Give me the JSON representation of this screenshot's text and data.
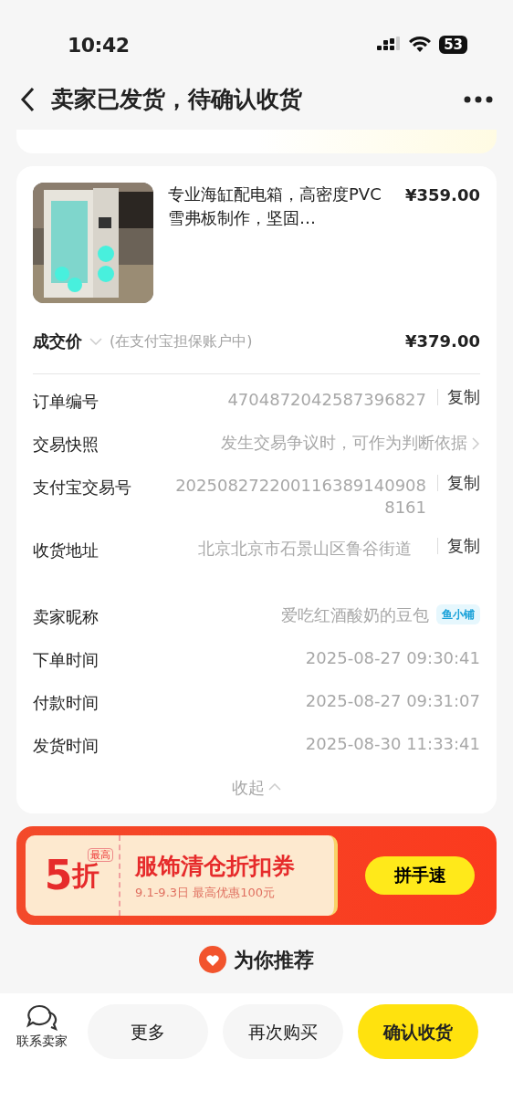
{
  "status_bar": {
    "time": "10:42",
    "battery": "53"
  },
  "header": {
    "title": "卖家已发货，待确认收货"
  },
  "product": {
    "title": "专业海缸配电箱，高密度PVC雪弗板制作，坚固…",
    "price": "¥359.00"
  },
  "deal": {
    "label": "成交价",
    "note": "(在支付宝担保账户中)",
    "price": "¥379.00"
  },
  "details": [
    {
      "kind": "copy",
      "label": "订单编号",
      "value": "4704872042587396827",
      "action": "复制"
    },
    {
      "kind": "link",
      "label": "交易快照",
      "value": "发生交易争议时，可作为判断依据"
    },
    {
      "kind": "copy",
      "label": "支付宝交易号",
      "value": "2025082722001163891409088161",
      "action": "复制"
    },
    {
      "kind": "address",
      "label": "收货地址",
      "value": "北京北京市石景山区鲁谷街道",
      "action": "复制"
    },
    {
      "kind": "seller",
      "label": "卖家昵称",
      "value": "爱吃红酒酸奶的豆包",
      "badge": "鱼小铺"
    },
    {
      "kind": "plain",
      "label": "下单时间",
      "value": "2025-08-27 09:30:41"
    },
    {
      "kind": "plain",
      "label": "付款时间",
      "value": "2025-08-27 09:31:07"
    },
    {
      "kind": "plain",
      "label": "发货时间",
      "value": "2025-08-30 11:33:41"
    }
  ],
  "collapse": "收起",
  "promo": {
    "tag": "最高",
    "discount": "5",
    "unit": "折",
    "title": "服饰清仓折扣券",
    "subtitle": "9.1-9.3日 最高优惠100元",
    "button": "拼手速"
  },
  "recommend": "为你推荐",
  "bottom_bar": {
    "contact": "联系卖家",
    "buttons": [
      {
        "label": "更多",
        "kind": "secondary"
      },
      {
        "label": "再次购买",
        "kind": "secondary"
      },
      {
        "label": "确认收货",
        "kind": "primary"
      }
    ]
  }
}
